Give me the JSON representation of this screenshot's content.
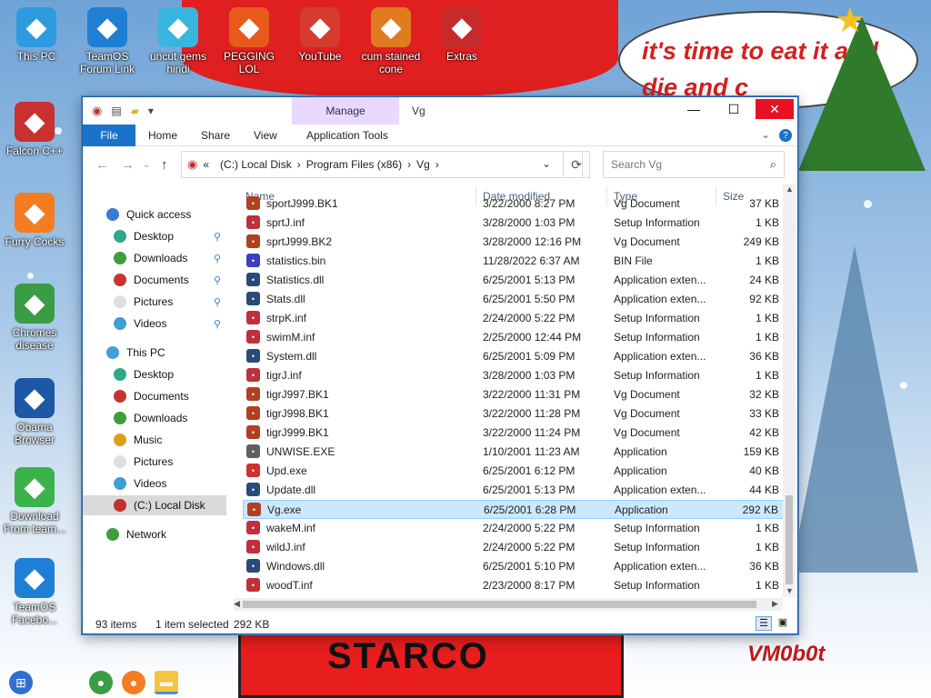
{
  "desktop": {
    "bubble_text": "it's time to eat it and die and c",
    "body_text": "STARCO",
    "signature": "VM0b0t",
    "icons_top": [
      {
        "label": "This PC",
        "icon": "monitor-icon",
        "color": "#2e9be0"
      },
      {
        "label": "TeamOS Forum Link",
        "icon": "gear-icon",
        "color": "#1f7fd4"
      },
      {
        "label": "uncut gems hindi",
        "icon": "gem-icon",
        "color": "#39b6e0"
      },
      {
        "label": "PEGGING LOL",
        "icon": "p-logo-icon",
        "color": "#e85a1b"
      },
      {
        "label": "YouTube",
        "icon": "angry-bird-icon",
        "color": "#d63b2f"
      },
      {
        "label": "cum stained cone",
        "icon": "cone-icon",
        "color": "#e07b20"
      },
      {
        "label": "Extras",
        "icon": "gift-icon",
        "color": "#c62b2b"
      }
    ],
    "icons_left": [
      {
        "label": "Falcon C++",
        "icon": "recycle-icon",
        "color": "#c93030"
      },
      {
        "label": "Furry Cocks",
        "icon": "firefox-icon",
        "color": "#f57c20"
      },
      {
        "label": "Chromes disease",
        "icon": "chrome-icon",
        "color": "#3a9c45"
      },
      {
        "label": "Obama Browser",
        "icon": "obama-logo-icon",
        "color": "#1d57a6"
      },
      {
        "label": "Download From team...",
        "icon": "notepad-icon",
        "color": "#3bb34a"
      },
      {
        "label": "TeamOS Facebo...",
        "icon": "gear-icon",
        "color": "#1f7fd4"
      }
    ]
  },
  "window": {
    "ribbon_context": "Manage",
    "title": "Vg",
    "tabs": [
      "File",
      "Home",
      "Share",
      "View",
      "Application Tools"
    ],
    "address": {
      "prefix": "«",
      "segments": [
        "(C:) Local Disk",
        "Program Files (x86)",
        "Vg"
      ]
    },
    "search_placeholder": "Search Vg",
    "nav": {
      "quick_access": "Quick access",
      "quick_items": [
        "Desktop",
        "Downloads",
        "Documents",
        "Pictures",
        "Videos"
      ],
      "this_pc": "This PC",
      "pc_items": [
        "Desktop",
        "Documents",
        "Downloads",
        "Music",
        "Pictures",
        "Videos",
        "(C:) Local Disk"
      ],
      "network": "Network"
    },
    "columns": {
      "name": "Name",
      "date": "Date modified",
      "type": "Type",
      "size": "Size"
    },
    "files": [
      {
        "name": "sportJ999.BK1",
        "date": "3/22/2000 8:27 PM",
        "type": "Vg Document",
        "size": "37 KB",
        "icon": "#b04020"
      },
      {
        "name": "sprtJ.inf",
        "date": "3/28/2000 1:03 PM",
        "type": "Setup Information",
        "size": "1 KB",
        "icon": "#c0303a"
      },
      {
        "name": "sprtJ999.BK2",
        "date": "3/28/2000 12:16 PM",
        "type": "Vg Document",
        "size": "249 KB",
        "icon": "#b04020"
      },
      {
        "name": "statistics.bin",
        "date": "11/28/2022 6:37 AM",
        "type": "BIN File",
        "size": "1 KB",
        "icon": "#3a40c0"
      },
      {
        "name": "Statistics.dll",
        "date": "6/25/2001 5:13 PM",
        "type": "Application exten...",
        "size": "24 KB",
        "icon": "#2a4a7a"
      },
      {
        "name": "Stats.dll",
        "date": "6/25/2001 5:50 PM",
        "type": "Application exten...",
        "size": "92 KB",
        "icon": "#2a4a7a"
      },
      {
        "name": "strpK.inf",
        "date": "2/24/2000 5:22 PM",
        "type": "Setup Information",
        "size": "1 KB",
        "icon": "#c0303a"
      },
      {
        "name": "swimM.inf",
        "date": "2/25/2000 12:44 PM",
        "type": "Setup Information",
        "size": "1 KB",
        "icon": "#c0303a"
      },
      {
        "name": "System.dll",
        "date": "6/25/2001 5:09 PM",
        "type": "Application exten...",
        "size": "36 KB",
        "icon": "#2a4a7a"
      },
      {
        "name": "tigrJ.inf",
        "date": "3/28/2000 1:03 PM",
        "type": "Setup Information",
        "size": "1 KB",
        "icon": "#c0303a"
      },
      {
        "name": "tigrJ997.BK1",
        "date": "3/22/2000 11:31 PM",
        "type": "Vg Document",
        "size": "32 KB",
        "icon": "#b04020"
      },
      {
        "name": "tigrJ998.BK1",
        "date": "3/22/2000 11:28 PM",
        "type": "Vg Document",
        "size": "33 KB",
        "icon": "#b04020"
      },
      {
        "name": "tigrJ999.BK1",
        "date": "3/22/2000 11:24 PM",
        "type": "Vg Document",
        "size": "42 KB",
        "icon": "#b04020"
      },
      {
        "name": "UNWISE.EXE",
        "date": "1/10/2001 11:23 AM",
        "type": "Application",
        "size": "159 KB",
        "icon": "#606060"
      },
      {
        "name": "Upd.exe",
        "date": "6/25/2001 6:12 PM",
        "type": "Application",
        "size": "40 KB",
        "icon": "#d03030"
      },
      {
        "name": "Update.dll",
        "date": "6/25/2001 5:13 PM",
        "type": "Application exten...",
        "size": "44 KB",
        "icon": "#2a4a7a"
      },
      {
        "name": "Vg.exe",
        "date": "6/25/2001 6:28 PM",
        "type": "Application",
        "size": "292 KB",
        "icon": "#b04020",
        "selected": true
      },
      {
        "name": "wakeM.inf",
        "date": "2/24/2000 5:22 PM",
        "type": "Setup Information",
        "size": "1 KB",
        "icon": "#c0303a"
      },
      {
        "name": "wildJ.inf",
        "date": "2/24/2000 5:22 PM",
        "type": "Setup Information",
        "size": "1 KB",
        "icon": "#c0303a"
      },
      {
        "name": "Windows.dll",
        "date": "6/25/2001 5:10 PM",
        "type": "Application exten...",
        "size": "36 KB",
        "icon": "#2a4a7a"
      },
      {
        "name": "woodT.inf",
        "date": "2/23/2000 8:17 PM",
        "type": "Setup Information",
        "size": "1 KB",
        "icon": "#c0303a"
      }
    ],
    "status": {
      "count": "93 items",
      "selected": "1 item selected",
      "size": "292 KB"
    }
  }
}
